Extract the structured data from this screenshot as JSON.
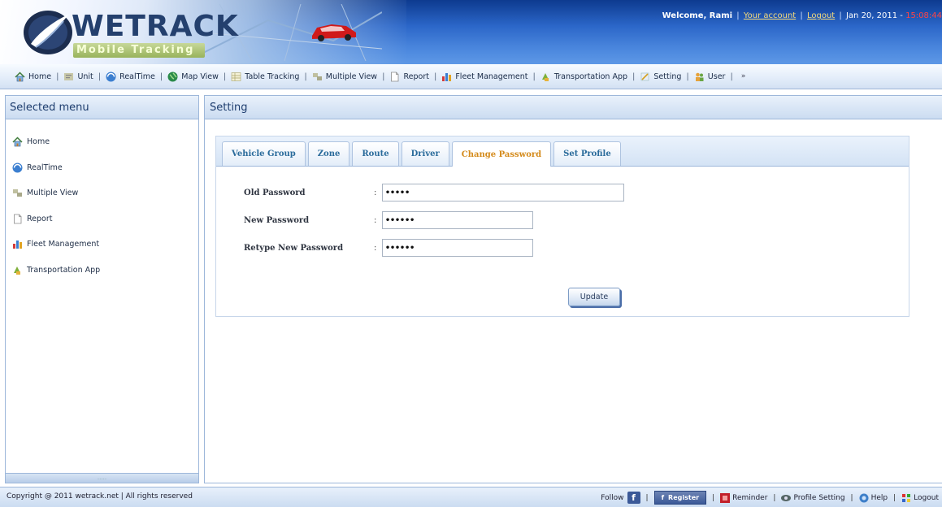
{
  "header": {
    "logo_text": "WETRACK",
    "logo_subtitle": "Mobile Tracking",
    "welcome_text": "Welcome, Rami",
    "your_account": "Your account",
    "logout": "Logout",
    "date": "Jan 20, 2011 -",
    "clock": "15:08:44",
    "sep": "|"
  },
  "nav": {
    "items": [
      {
        "label": "Home",
        "icon": "house"
      },
      {
        "label": "Unit",
        "icon": "unit"
      },
      {
        "label": "RealTime",
        "icon": "realtime"
      },
      {
        "label": "Map View",
        "icon": "globe"
      },
      {
        "label": "Table Tracking",
        "icon": "table"
      },
      {
        "label": "Multiple View",
        "icon": "multiple"
      },
      {
        "label": "Report",
        "icon": "document"
      },
      {
        "label": "Fleet Management",
        "icon": "chart"
      },
      {
        "label": "Transportation App",
        "icon": "transport"
      },
      {
        "label": "Setting",
        "icon": "setting"
      },
      {
        "label": "User",
        "icon": "user"
      }
    ],
    "separator": "|",
    "overflow": "»"
  },
  "sidebar": {
    "title": "Selected menu",
    "items": [
      {
        "label": "Home",
        "icon": "house"
      },
      {
        "label": "RealTime",
        "icon": "realtime"
      },
      {
        "label": "Multiple View",
        "icon": "multiple"
      },
      {
        "label": "Report",
        "icon": "document"
      },
      {
        "label": "Fleet Management",
        "icon": "chart"
      },
      {
        "label": "Transportation App",
        "icon": "transport"
      }
    ],
    "splitter_grip": "....."
  },
  "main": {
    "title": "Setting",
    "tabs": [
      {
        "label": "Vehicle Group",
        "active": false
      },
      {
        "label": "Zone",
        "active": false
      },
      {
        "label": "Route",
        "active": false
      },
      {
        "label": "Driver",
        "active": false
      },
      {
        "label": "Change Password",
        "active": true
      },
      {
        "label": "Set Profile",
        "active": false
      }
    ],
    "form": {
      "old_password_label": "Old Password",
      "old_password_value": "•••••",
      "new_password_label": "New Password",
      "new_password_value": "••••••",
      "retype_label": "Retype New Password",
      "retype_value": "••••••",
      "colon": ":",
      "update_button": "Update"
    }
  },
  "footer": {
    "copyright": "Copyright @ 2011 wetrack.net | All rights reserved",
    "follow": "Follow",
    "fb_letter": "f",
    "register": "Register",
    "reminder": "Reminder",
    "profile_setting": "Profile Setting",
    "help": "Help",
    "logout": "Logout",
    "sep": "|"
  },
  "colors": {
    "header_blue": "#2b66c8",
    "tab_text": "#2a6b9b",
    "active_tab_text": "#d48a1a",
    "panel_border": "#9db7da",
    "facebook_blue": "#3b5998",
    "clock_red": "#ff4444"
  }
}
